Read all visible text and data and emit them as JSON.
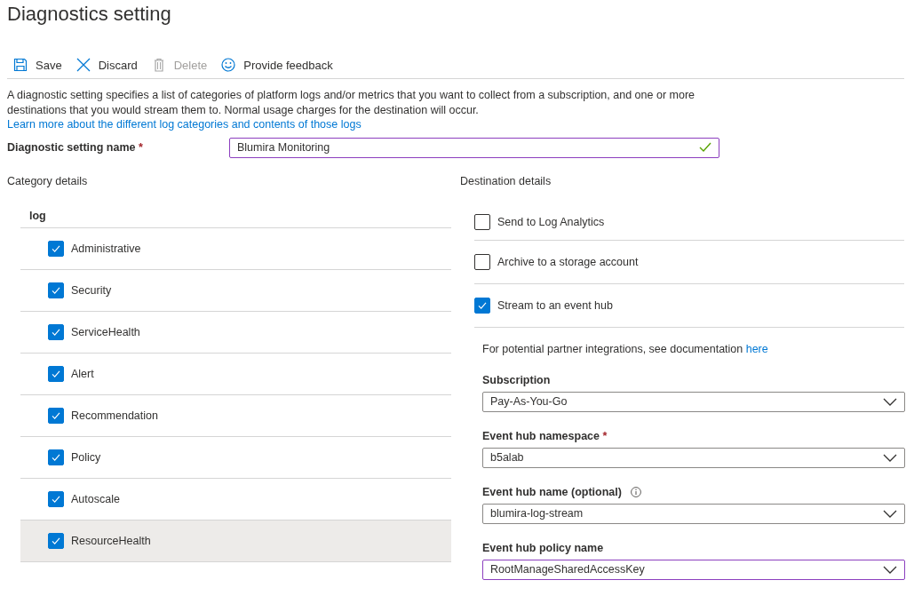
{
  "title": "Diagnostics setting",
  "toolbar": [
    {
      "kind": "save",
      "label": "Save",
      "disabled": false
    },
    {
      "kind": "discard",
      "label": "Discard",
      "disabled": false
    },
    {
      "kind": "delete",
      "label": "Delete",
      "disabled": true
    },
    {
      "kind": "feedback",
      "label": "Provide feedback",
      "disabled": false
    }
  ],
  "description": {
    "text": "A diagnostic setting specifies a list of categories of platform logs and/or metrics that you want to collect from a subscription, and one or more destinations that you would stream them to. Normal usage charges for the destination will occur.",
    "link": "Learn more about the different log categories and contents of those logs"
  },
  "setting_name": {
    "label": "Diagnostic setting name",
    "required_mark": "*",
    "value": "Blumira Monitoring",
    "focused": true,
    "valid": true
  },
  "category_details": {
    "heading": "Category details",
    "group": "log",
    "items": [
      {
        "label": "Administrative",
        "checked": true,
        "highlighted": false
      },
      {
        "label": "Security",
        "checked": true,
        "highlighted": false
      },
      {
        "label": "ServiceHealth",
        "checked": true,
        "highlighted": false
      },
      {
        "label": "Alert",
        "checked": true,
        "highlighted": false
      },
      {
        "label": "Recommendation",
        "checked": true,
        "highlighted": false
      },
      {
        "label": "Policy",
        "checked": true,
        "highlighted": false
      },
      {
        "label": "Autoscale",
        "checked": true,
        "highlighted": false
      },
      {
        "label": "ResourceHealth",
        "checked": true,
        "highlighted": true
      }
    ]
  },
  "destination_details": {
    "heading": "Destination details",
    "options": [
      {
        "label": "Send to Log Analytics",
        "checked": false
      },
      {
        "label": "Archive to a storage account",
        "checked": false
      },
      {
        "label": "Stream to an event hub",
        "checked": true
      }
    ],
    "note": {
      "text": "For potential partner integrations, see documentation",
      "link": "here"
    },
    "fields": [
      {
        "label": "Subscription",
        "info": false,
        "value": "Pay-As-You-Go",
        "focused": false
      },
      {
        "label": "Event hub namespace",
        "required_mark": "*",
        "info": false,
        "value": "b5alab",
        "focused": false
      },
      {
        "label": "Event hub name (optional)",
        "info": true,
        "value": "blumira-log-stream",
        "focused": false
      },
      {
        "label": "Event hub policy name",
        "info": false,
        "value": "RootManageSharedAccessKey",
        "focused": true
      }
    ]
  }
}
